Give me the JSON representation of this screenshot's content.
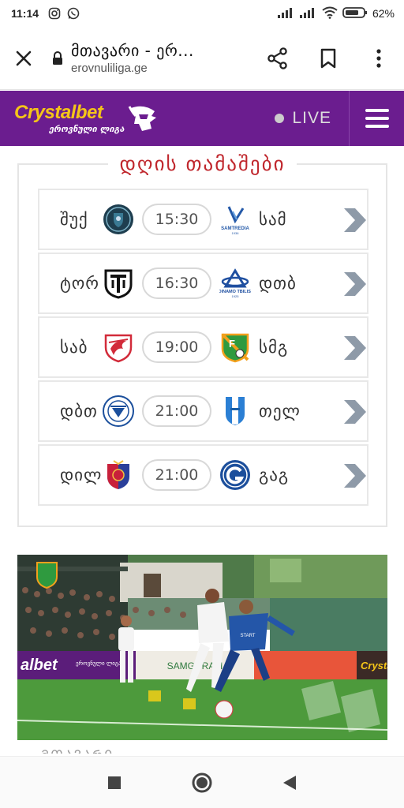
{
  "status_bar": {
    "time": "11:14",
    "battery": "62%"
  },
  "browser": {
    "title": "მთავარი - ერ...",
    "url": "erovnuliliga.ge"
  },
  "header": {
    "brand": "Crystalbet",
    "brand_sub": "ეროვნული ლიგა",
    "live_label": "LIVE",
    "brand_color": "#6b1d8f",
    "accent_color": "#f5c518"
  },
  "games": {
    "title": "დღის თამაშები",
    "matches": [
      {
        "home": "შუქ",
        "time": "15:30",
        "away": "სამ",
        "home_icon": "shukura-crest-icon",
        "away_icon": "samtredia-crest-icon"
      },
      {
        "home": "ტორ",
        "time": "16:30",
        "away": "დთბ",
        "home_icon": "torpedo-crest-icon",
        "away_icon": "dinamo-tbilisi-crest-icon"
      },
      {
        "home": "საბ",
        "time": "19:00",
        "away": "სმგ",
        "home_icon": "saburtalo-crest-icon",
        "away_icon": "samgurali-crest-icon"
      },
      {
        "home": "დბთ",
        "time": "21:00",
        "away": "თელ",
        "home_icon": "dinamo-batumi-crest-icon",
        "away_icon": "telavi-crest-icon"
      },
      {
        "home": "დილ",
        "time": "21:00",
        "away": "გაგ",
        "home_icon": "dila-crest-icon",
        "away_icon": "gagra-crest-icon"
      }
    ]
  },
  "photo": {
    "board_left": "albet",
    "board_left_sub": "ეროვნული ლიგა",
    "board_mid": "SAMGURALI",
    "board_right": "Crysta"
  },
  "below_photo_text": "ᲛᲗᲐᲕᲐᲠᲘ"
}
